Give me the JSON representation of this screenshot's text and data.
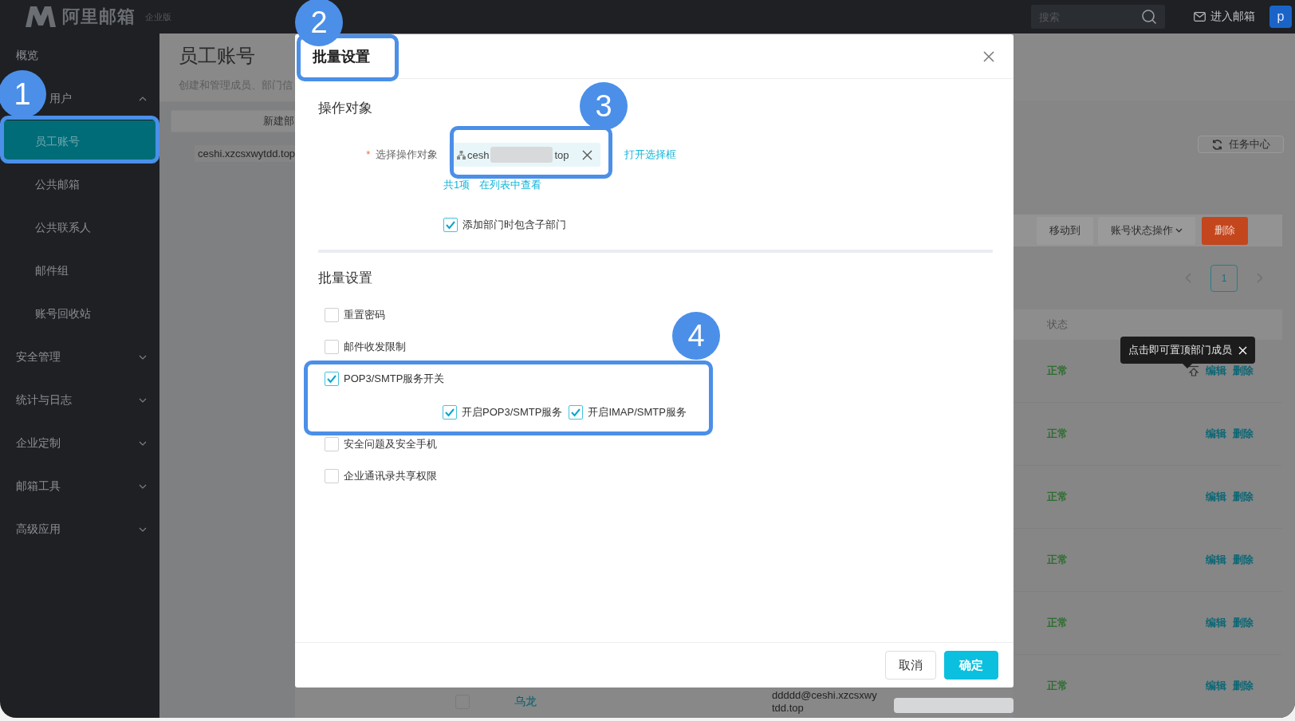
{
  "top_bar": {
    "logo_text": "阿里邮箱",
    "edition": "企业版",
    "search": {
      "placeholder": "搜索"
    },
    "mailbox_link": "进入邮箱",
    "avatar": "p"
  },
  "sidebar": {
    "items": [
      {
        "label": "概览",
        "kind": "item"
      },
      {
        "label": "用户",
        "kind": "group",
        "expanded": true,
        "children": [
          {
            "label": "员工账号",
            "selected": true
          },
          {
            "label": "公共邮箱",
            "selected": false
          },
          {
            "label": "公共联系人",
            "selected": false
          },
          {
            "label": "邮件组",
            "selected": false
          },
          {
            "label": "账号回收站",
            "selected": false
          }
        ]
      },
      {
        "label": "安全管理",
        "kind": "group",
        "expanded": false
      },
      {
        "label": "统计与日志",
        "kind": "group",
        "expanded": false
      },
      {
        "label": "企业定制",
        "kind": "group",
        "expanded": false
      },
      {
        "label": "邮箱工具",
        "kind": "group",
        "expanded": false
      },
      {
        "label": "高级应用",
        "kind": "group",
        "expanded": false
      }
    ]
  },
  "page": {
    "title": "员工账号",
    "subtitle": "创建和管理成员、部门信",
    "new_department_button": "新建部",
    "domain": "ceshi.xzcsxwytdd.top",
    "task_center_button": "任务中心",
    "toolbar": [
      {
        "label": "移动到",
        "kind": "plain"
      },
      {
        "label": "账号状态操作",
        "kind": "dropdown"
      },
      {
        "label": "删除",
        "kind": "danger"
      }
    ],
    "pagination": [
      {
        "label": "1",
        "selected": true
      }
    ],
    "table": {
      "columns": [
        "状态"
      ],
      "rows": [
        {
          "status": "正常",
          "actions": [
            "编辑",
            "删除"
          ],
          "pinnable": true
        },
        {
          "status": "正常",
          "actions": [
            "编辑",
            "删除"
          ],
          "pinnable": false
        },
        {
          "status": "正常",
          "actions": [
            "编辑",
            "删除"
          ],
          "pinnable": false
        },
        {
          "status": "正常",
          "actions": [
            "编辑",
            "删除"
          ],
          "pinnable": false
        },
        {
          "status": "正常",
          "actions": [
            "编辑",
            "删除"
          ],
          "pinnable": false
        },
        {
          "status": "正常",
          "actions": [
            "编辑",
            "删除"
          ],
          "pinnable": false,
          "name": "乌龙",
          "email": "ddddd@ceshi.xzcsxwytdd.top",
          "checked": false
        }
      ]
    },
    "tooltip": {
      "text": "点击即可置顶部门成员"
    }
  },
  "modal": {
    "title": "批量设置",
    "target": {
      "heading": "操作对象",
      "required_mark": "*",
      "field_label": "选择操作对象",
      "chip": {
        "prefix": "cesh",
        "suffix": "top"
      },
      "open_picker_link": "打开选择框",
      "count": "共1项",
      "view_in_list_link": "在列表中查看",
      "include_subdepartments": {
        "label": "添加部门时包含子部门",
        "checked": true
      }
    },
    "settings": {
      "heading": "批量设置",
      "options": [
        {
          "label": "重置密码",
          "checked": false
        },
        {
          "label": "邮件收发限制",
          "checked": false
        },
        {
          "label": "POP3/SMTP服务开关",
          "checked": true,
          "children": [
            {
              "label": "开启POP3/SMTP服务",
              "checked": true
            },
            {
              "label": "开启IMAP/SMTP服务",
              "checked": true
            }
          ]
        },
        {
          "label": "安全问题及安全手机",
          "checked": false
        },
        {
          "label": "企业通讯录共享权限",
          "checked": false
        }
      ]
    },
    "buttons": [
      {
        "label": "取消",
        "kind": "secondary"
      },
      {
        "label": "确定",
        "kind": "primary"
      }
    ]
  },
  "annotations": [
    {
      "number": "1"
    },
    {
      "number": "2"
    },
    {
      "number": "3"
    },
    {
      "number": "4"
    }
  ]
}
